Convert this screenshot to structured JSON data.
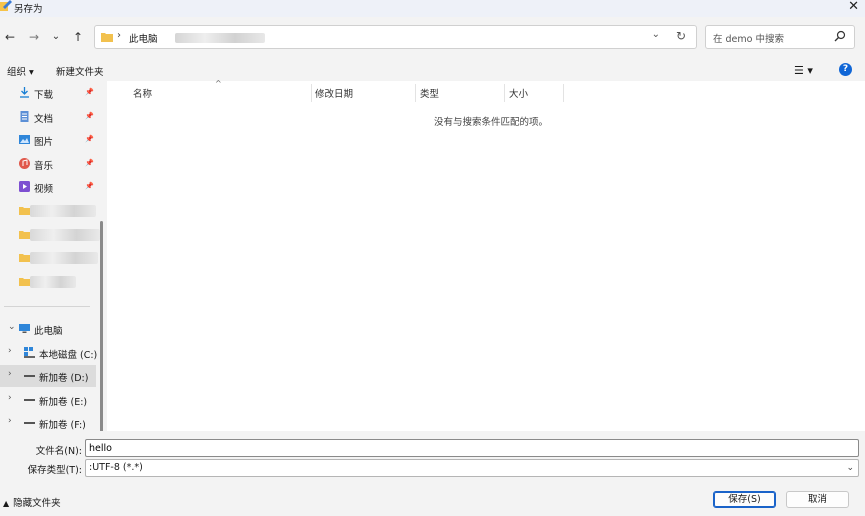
{
  "window": {
    "title": "另存为"
  },
  "nav": {
    "back": "←",
    "forward": "→",
    "dropdown": "⌄",
    "up": "↑"
  },
  "address": {
    "path_root": "此电脑",
    "separator": "›"
  },
  "search": {
    "placeholder": "在 demo 中搜索"
  },
  "toolbar": {
    "organize": "组织 ▾",
    "new_folder": "新建文件夹",
    "view": "☰ ▾",
    "help": "?"
  },
  "sidebar": {
    "quick_access": [
      {
        "label": "下载",
        "icon": "download-icon"
      },
      {
        "label": "文档",
        "icon": "document-icon"
      },
      {
        "label": "图片",
        "icon": "picture-icon"
      },
      {
        "label": "音乐",
        "icon": "music-icon"
      },
      {
        "label": "视频",
        "icon": "video-icon"
      }
    ],
    "this_pc": "此电脑",
    "drives": [
      {
        "label": "本地磁盘 (C:)",
        "icon": "windows-drive-icon"
      },
      {
        "label": "新加卷 (D:)",
        "icon": "drive-icon"
      },
      {
        "label": "新加卷 (E:)",
        "icon": "drive-icon"
      },
      {
        "label": "新加卷 (F:)",
        "icon": "drive-icon"
      }
    ]
  },
  "content": {
    "columns": [
      "名称",
      "修改日期",
      "类型",
      "大小"
    ],
    "empty_message": "没有与搜索条件匹配的项。"
  },
  "footer": {
    "filename_label": "文件名(N):",
    "filename_value": "hello",
    "filetype_label": "保存类型(T):",
    "filetype_value": ":UTF-8 (*.*)",
    "hide_folders": "隐藏文件夹",
    "save": "保存(S)",
    "cancel": "取消"
  },
  "colors": {
    "accent": "#1066d6",
    "folder": "#f2c14e",
    "selected": "#dcdcdc"
  }
}
